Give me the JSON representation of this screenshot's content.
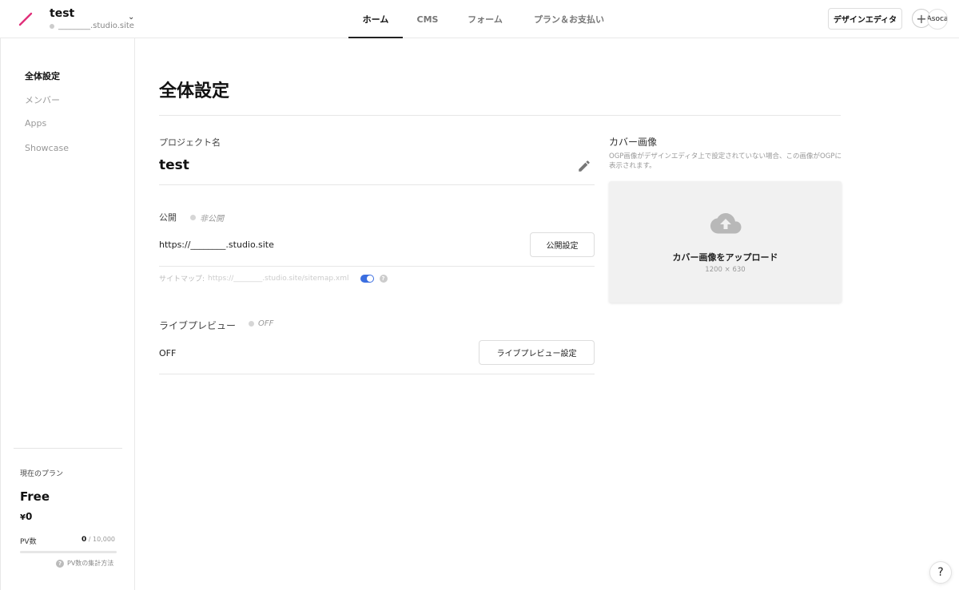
{
  "header": {
    "project_name": "test",
    "project_url": "________.studio.site",
    "tabs": [
      {
        "label": "ホーム",
        "active": true
      },
      {
        "label": "CMS",
        "active": false
      },
      {
        "label": "フォーム",
        "active": false
      },
      {
        "label": "プラン＆お支払い",
        "active": false
      }
    ],
    "design_editor_label": "デザインエディタ",
    "avatar_text": "Asoca"
  },
  "sidebar": {
    "items": [
      {
        "label": "全体設定",
        "active": true
      },
      {
        "label": "メンバー",
        "active": false
      },
      {
        "label": "Apps",
        "active": false
      },
      {
        "label": "Showcase",
        "active": false
      }
    ],
    "plan": {
      "label": "現在のプラン",
      "name": "Free",
      "price_symbol": "¥",
      "price": "0",
      "pv_label": "PV数",
      "pv_count": "0",
      "pv_limit": " / 10,000",
      "pv_fraction": 0,
      "pv_help": "PV数の集計方法"
    }
  },
  "main": {
    "title": "全体設定",
    "project_name_label": "プロジェクト名",
    "project_name_value": "test",
    "publish": {
      "label": "公開",
      "status": "非公開",
      "url": "https://________.studio.site",
      "button": "公開設定",
      "sitemap_label": "サイトマップ:",
      "sitemap_url": "https://________.studio.site/sitemap.xml",
      "sitemap_enabled": true
    },
    "live_preview": {
      "label": "ライブプレビュー",
      "status": "OFF",
      "value": "OFF",
      "button": "ライブプレビュー設定"
    },
    "cover": {
      "title": "カバー画像",
      "description": "OGP画像がデザインエディタ上で設定されていない場合、この画像がOGPに表示されます。",
      "upload_label": "カバー画像をアップロード",
      "size": "1200 × 630"
    }
  },
  "help_fab": "?",
  "colors": {
    "accent": "#e0307a",
    "toggle": "#3b6ee0"
  }
}
